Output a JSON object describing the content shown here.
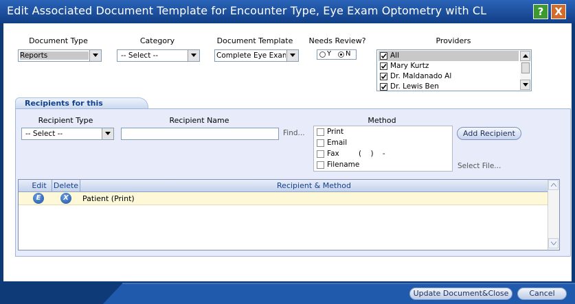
{
  "window": {
    "title": "Edit Associated Document Template for Encounter Type, Eye Exam Optometry with CL",
    "help_label": "?",
    "close_label": "X"
  },
  "form": {
    "document_type": {
      "label": "Document Type",
      "value": "Reports"
    },
    "category": {
      "label": "Category",
      "value": "-- Select --"
    },
    "document_template": {
      "label": "Document Template",
      "value": "Complete Eye Exam F"
    },
    "needs_review": {
      "label": "Needs Review?",
      "options": [
        "Y",
        "N"
      ],
      "selected": "N"
    },
    "providers": {
      "label": "Providers",
      "items": [
        {
          "label": "All",
          "checked": true,
          "selected": true
        },
        {
          "label": "Mary Kurtz",
          "checked": true,
          "selected": false
        },
        {
          "label": "Dr. Maldanado Al",
          "checked": true,
          "selected": false
        },
        {
          "label": "Dr. Lewis Ben",
          "checked": true,
          "selected": false
        }
      ]
    }
  },
  "recipients": {
    "tab_label": "Recipients for this document",
    "recipient_type": {
      "label": "Recipient Type",
      "value": "-- Select --"
    },
    "recipient_name": {
      "label": "Recipient Name",
      "value": "",
      "find_label": "Find..."
    },
    "method": {
      "label": "Method",
      "options": [
        {
          "label": "Print",
          "checked": false
        },
        {
          "label": "Email",
          "checked": false
        },
        {
          "label": "Fax",
          "checked": false,
          "phone_mask": "(    )    -"
        },
        {
          "label": "Filename",
          "checked": false
        }
      ],
      "select_file_label": "Select File..."
    },
    "add_button_label": "Add Recipient",
    "grid": {
      "headers": [
        "Edit",
        "Delete",
        "Recipient & Method"
      ],
      "rows": [
        {
          "edit_icon": "edit-icon",
          "delete_icon": "delete-icon",
          "recipient": "Patient (Print)"
        }
      ]
    }
  },
  "footer": {
    "update_label": "Update Document&Close",
    "cancel_label": "Cancel"
  },
  "colors": {
    "title_bar": "#1a4c9c",
    "help_button": "#3d9a2e",
    "close_button": "#d36b2a",
    "panel_bg": "#e8ecfa",
    "row_highlight": "#fdf9d8"
  }
}
